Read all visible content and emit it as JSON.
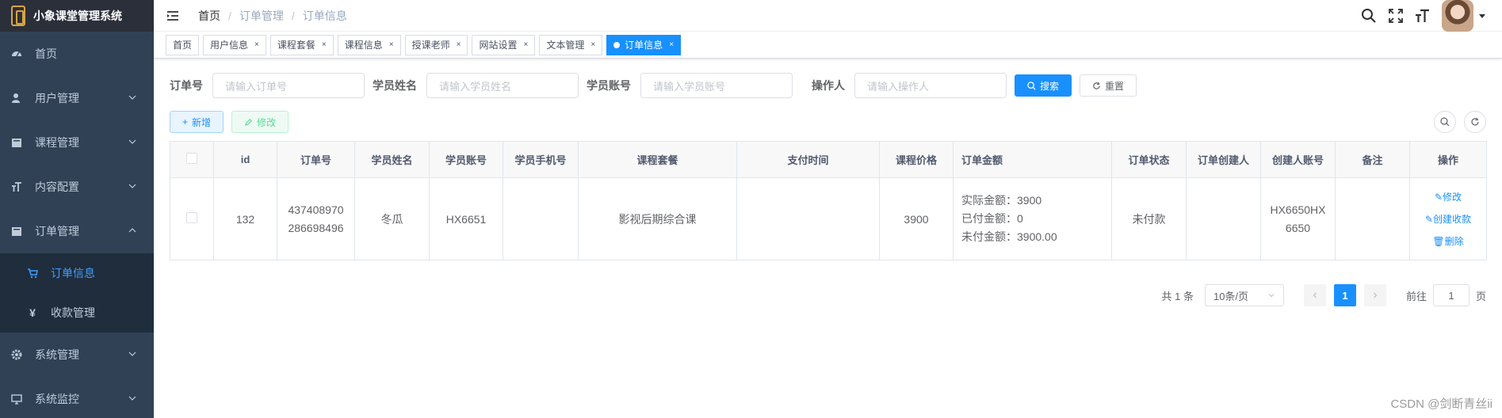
{
  "app": {
    "title": "小象课堂管理系统"
  },
  "sidebar": {
    "items": [
      {
        "label": "首页",
        "icon": "dashboard-icon",
        "has_arrow": false
      },
      {
        "label": "用户管理",
        "icon": "user-icon",
        "has_arrow": true
      },
      {
        "label": "课程管理",
        "icon": "folder-icon",
        "has_arrow": true
      },
      {
        "label": "内容配置",
        "icon": "font-size-icon",
        "has_arrow": true
      },
      {
        "label": "订单管理",
        "icon": "folder-icon",
        "has_arrow": true,
        "expanded": true
      }
    ],
    "submenu": [
      {
        "label": "订单信息",
        "icon": "cart-icon",
        "active": true
      },
      {
        "label": "收款管理",
        "icon": "yen-icon",
        "active": false
      }
    ],
    "items_after": [
      {
        "label": "系统管理",
        "icon": "gear-icon",
        "has_arrow": true
      },
      {
        "label": "系统监控",
        "icon": "monitor-icon",
        "has_arrow": true
      }
    ]
  },
  "breadcrumb": [
    "首页",
    "订单管理",
    "订单信息"
  ],
  "tags": [
    {
      "label": "首页",
      "closable": false,
      "active": false
    },
    {
      "label": "用户信息",
      "closable": true,
      "active": false
    },
    {
      "label": "课程套餐",
      "closable": true,
      "active": false
    },
    {
      "label": "课程信息",
      "closable": true,
      "active": false
    },
    {
      "label": "授课老师",
      "closable": true,
      "active": false
    },
    {
      "label": "网站设置",
      "closable": true,
      "active": false
    },
    {
      "label": "文本管理",
      "closable": true,
      "active": false
    },
    {
      "label": "订单信息",
      "closable": true,
      "active": true
    }
  ],
  "search": {
    "fields": [
      {
        "label": "订单号",
        "placeholder": "请输入订单号"
      },
      {
        "label": "学员姓名",
        "placeholder": "请输入学员姓名"
      },
      {
        "label": "学员账号",
        "placeholder": "请输入学员账号"
      },
      {
        "label": "操作人",
        "placeholder": "请输入操作人"
      }
    ],
    "search_label": "搜索",
    "reset_label": "重置"
  },
  "toolbar": {
    "add_label": "新增",
    "edit_label": "修改"
  },
  "table": {
    "columns": [
      "id",
      "订单号",
      "学员姓名",
      "学员账号",
      "学员手机号",
      "课程套餐",
      "支付时间",
      "课程价格",
      "订单金额",
      "订单状态",
      "订单创建人",
      "创建人账号",
      "备注",
      "操作"
    ],
    "rows": [
      {
        "id": "132",
        "order_no_1": "437408970",
        "order_no_2": "286698496",
        "student_name": "冬瓜",
        "student_account": "HX6651",
        "student_phone": "",
        "package": "影视后期综合课",
        "pay_time": "",
        "price": "3900",
        "amount_actual": "实际金额：3900",
        "amount_paid": "已付金额：0",
        "amount_unpaid": "未付金额：3900.00",
        "status": "未付款",
        "creator": "",
        "creator_account_1": "HX6650HX",
        "creator_account_2": "6650",
        "remark": "",
        "op_edit": "修改",
        "op_receipt": "创建收款",
        "op_delete": "删除"
      }
    ]
  },
  "pagination": {
    "total": "共 1 条",
    "page_size": "10条/页",
    "current": "1",
    "goto_prefix": "前往",
    "goto_value": "1",
    "goto_suffix": "页"
  },
  "watermark": "CSDN @剑断青丝ii",
  "colors": {
    "sidebar_bg": "#304156",
    "submenu_bg": "#1f2d3d",
    "accent": "#1890ff",
    "menu_text": "#bfcbd9"
  }
}
